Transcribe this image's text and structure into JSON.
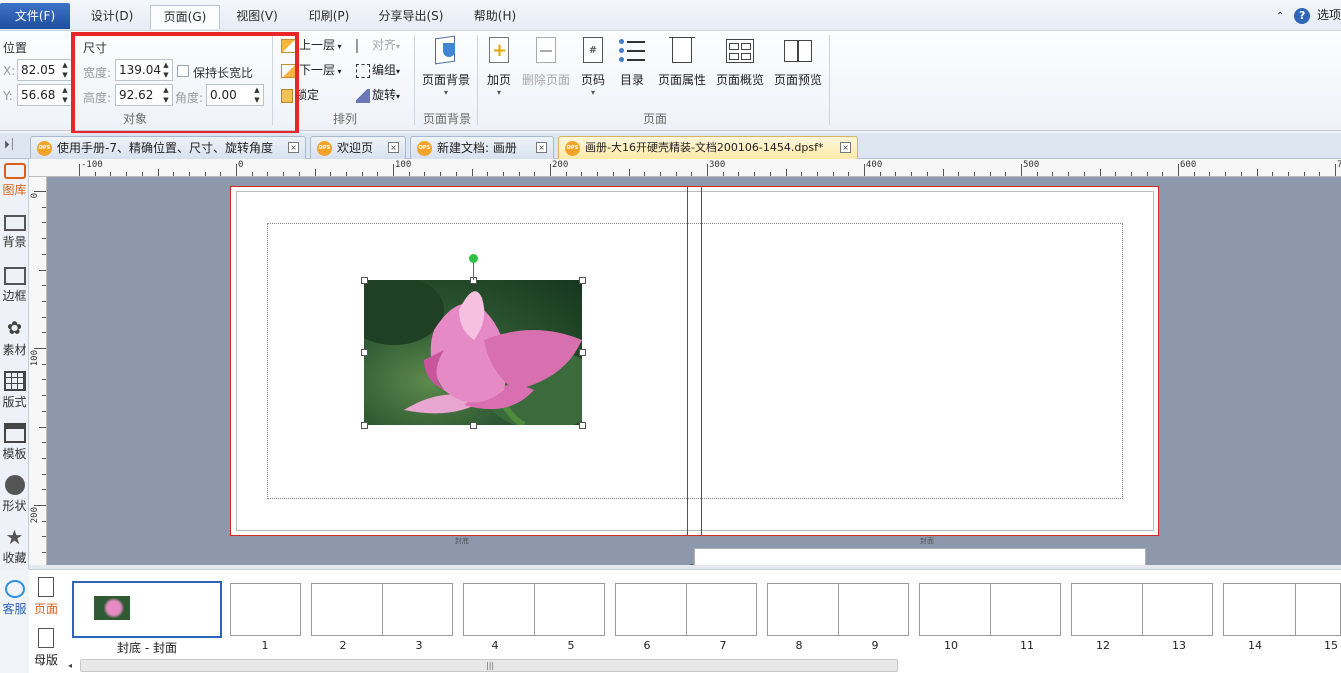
{
  "menubar": {
    "items": [
      "文件(F)",
      "设计(D)",
      "页面(G)",
      "视图(V)",
      "印刷(P)",
      "分享导出(S)",
      "帮助(H)"
    ],
    "right_text": "选项"
  },
  "ribbon": {
    "position": {
      "title": "位置",
      "x_label": "X:",
      "x_value": "82.05",
      "y_label": "Y:",
      "y_value": "56.68"
    },
    "size": {
      "title": "尺寸",
      "width_label": "宽度:",
      "width_value": "139.04",
      "height_label": "高度:",
      "height_value": "92.62",
      "keep_ratio": "保持长宽比",
      "angle_label": "角度:",
      "angle_value": "0.00"
    },
    "object_group": "对象",
    "arrange": {
      "up": "上一层",
      "down": "下一层",
      "lock": "锁定",
      "align": "对齐",
      "group": "编组",
      "rotate": "旋转",
      "label": "排列"
    },
    "page_bg": {
      "button": "页面背景",
      "label": "页面背景"
    },
    "page": {
      "add": "加页",
      "delete": "删除页面",
      "page_no": "页码",
      "toc": "目录",
      "props": "页面属性",
      "overview": "页面概览",
      "preview": "页面预览",
      "label": "页面"
    }
  },
  "tabs": [
    {
      "title": "使用手册-7、精确位置、尺寸、旋转角度",
      "icon": "dps-icon"
    },
    {
      "title": "欢迎页",
      "icon": "dps-icon"
    },
    {
      "title": "新建文档: 画册",
      "icon": "dps-icon"
    },
    {
      "title": "画册-大16开硬壳精装-文档200106-1454.dpsf*",
      "icon": "dps-icon"
    }
  ],
  "sidebar": [
    "图库",
    "背景",
    "边框",
    "素材",
    "版式",
    "模板",
    "形状",
    "收藏",
    "客服"
  ],
  "hruler": [
    "-100",
    "0",
    "100",
    "200",
    "300",
    "400",
    "500",
    "600",
    "70"
  ],
  "vruler": [
    "0",
    "100",
    "200"
  ],
  "canvas": {
    "left_label": "封底",
    "right_label": "封面"
  },
  "thumbs": {
    "cover_label": "封底 - 封面",
    "numbers": [
      "1",
      "2",
      "3",
      "4",
      "5",
      "6",
      "7",
      "8",
      "9",
      "10",
      "11",
      "12",
      "13",
      "14",
      "15"
    ]
  },
  "bottom_tabs": {
    "page": "页面",
    "master": "母版"
  },
  "colors": {
    "accent": "#2f64b8",
    "highlight": "#e8262a",
    "canvas": "#8e98ac"
  }
}
